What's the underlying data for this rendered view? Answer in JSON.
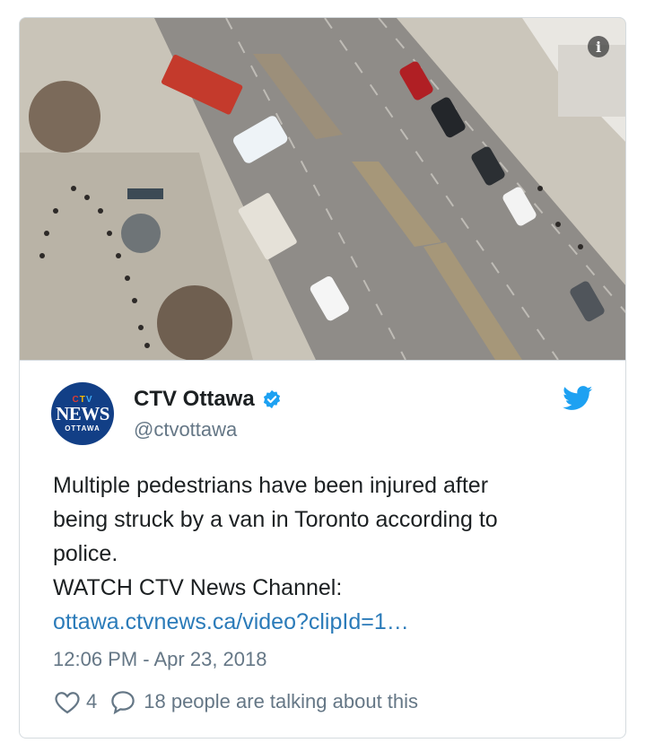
{
  "tweet": {
    "display_name": "CTV Ottawa",
    "handle": "@ctvottawa",
    "avatar": {
      "logo_top": "CTV",
      "logo_main": "NEWS",
      "logo_sub": "OTTAWA"
    },
    "text_lines": [
      "Multiple pedestrians have been injured after",
      "being struck by a van in Toronto according to",
      "police.",
      "WATCH CTV News Channel:"
    ],
    "link": "ottawa.ctvnews.ca/video?clipId=1…",
    "timestamp": "12:06 PM - Apr 23, 2018",
    "likes": "4",
    "talking": "18 people are talking about this"
  },
  "media": {
    "info_label": "i"
  },
  "icons": {
    "info": "info-icon",
    "verified": "verified-badge-icon",
    "twitter": "twitter-bird-icon",
    "like": "heart-icon",
    "reply": "speech-bubble-icon"
  },
  "colors": {
    "link": "#2b7bb9",
    "muted": "#657786",
    "verified": "#1da1f2",
    "avatar_bg": "#123f86"
  }
}
